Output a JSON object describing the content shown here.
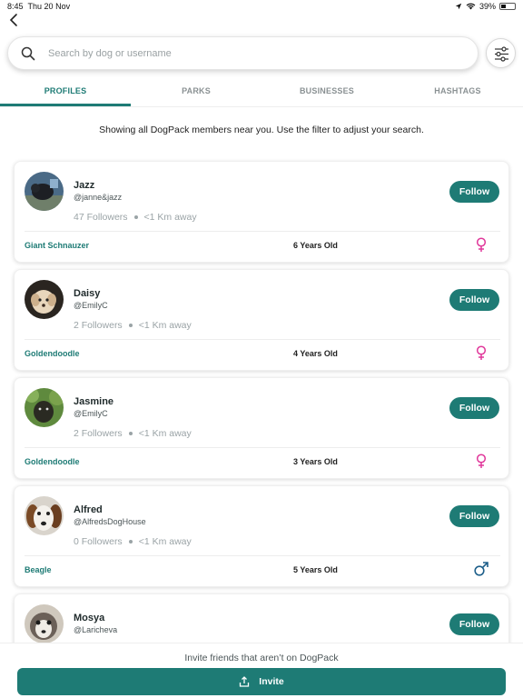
{
  "status_bar": {
    "time": "8:45",
    "date": "Thu 20 Nov",
    "battery": "39%",
    "battery_level": 0.39
  },
  "search": {
    "placeholder": "Search by dog or username",
    "value": ""
  },
  "tabs": [
    {
      "label": "PROFILES",
      "active": true
    },
    {
      "label": "PARKS",
      "active": false
    },
    {
      "label": "BUSINESSES",
      "active": false
    },
    {
      "label": "HASHTAGS",
      "active": false
    }
  ],
  "info_text": "Showing all DogPack members near you. Use the filter to adjust your search.",
  "profiles": [
    {
      "name": "Jazz",
      "username": "@janne&jazz",
      "followers": "47 Followers",
      "distance": "<1 Km away",
      "breed": "Giant Schnauzer",
      "age": "6 Years Old",
      "gender": "female",
      "follow_label": "Follow"
    },
    {
      "name": "Daisy",
      "username": "@EmilyC",
      "followers": "2 Followers",
      "distance": "<1 Km away",
      "breed": "Goldendoodle",
      "age": "4 Years Old",
      "gender": "female",
      "follow_label": "Follow"
    },
    {
      "name": "Jasmine",
      "username": "@EmilyC",
      "followers": "2 Followers",
      "distance": "<1 Km away",
      "breed": "Goldendoodle",
      "age": "3 Years Old",
      "gender": "female",
      "follow_label": "Follow"
    },
    {
      "name": "Alfred",
      "username": "@AlfredsDogHouse",
      "followers": "0 Followers",
      "distance": "<1 Km away",
      "breed": "Beagle",
      "age": "5 Years Old",
      "gender": "male",
      "follow_label": "Follow"
    },
    {
      "name": "Mosya",
      "username": "@Laricheva",
      "follow_label": "Follow"
    }
  ],
  "invite": {
    "prompt": "Invite friends that aren’t on DogPack",
    "button_label": "Invite"
  },
  "colors": {
    "accent": "#1e7b75",
    "female": "#e0379a",
    "male": "#1d5f8a"
  }
}
